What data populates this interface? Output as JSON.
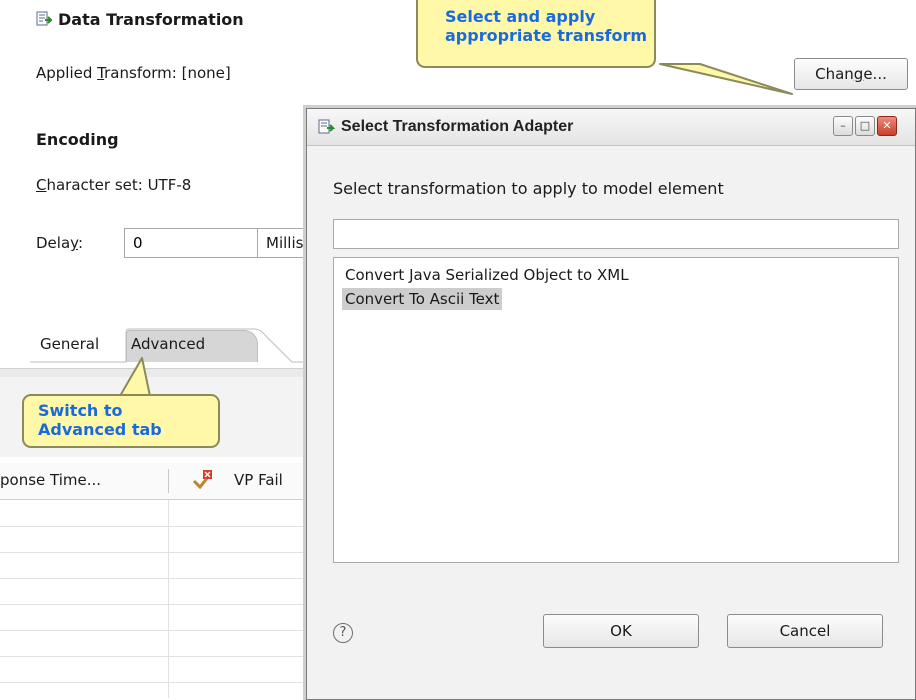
{
  "editor": {
    "section_title": "Data Transformation",
    "applied_transform_pre": "Applied ",
    "applied_transform_mnemonic": "T",
    "applied_transform_post": "ransform: [none]",
    "change_pre": "Chan",
    "change_mnemonic": "g",
    "change_post": "e...",
    "encoding_title": "Encoding",
    "charset_mnemonic": "C",
    "charset_post": "haracter set: UTF-8",
    "delay_pre": "Dela",
    "delay_mnemonic": "y",
    "delay_post": ":",
    "delay_value": "0",
    "delay_unit": "Millis"
  },
  "tabs": [
    {
      "label": "General",
      "selected": false
    },
    {
      "label": "Advanced",
      "selected": true
    }
  ],
  "table": {
    "col_response": "ponse Time...",
    "col_vp": "VP Fail"
  },
  "callouts": {
    "top_line1": "Select and apply",
    "top_line2": "appropriate transform",
    "bottom_line1": "Switch to",
    "bottom_line2": "Advanced tab"
  },
  "dialog": {
    "title": "Select Transformation Adapter",
    "prompt": "Select transformation to apply to model element",
    "filter_value": "",
    "items": [
      {
        "label": "Convert Java Serialized Object to XML",
        "selected": false
      },
      {
        "label": "Convert To Ascii Text",
        "selected": true
      }
    ],
    "help_glyph": "?",
    "ok_label": "OK",
    "cancel_label": "Cancel"
  },
  "colors": {
    "callout_fill": "#fff8a8",
    "callout_text": "#1a6adf",
    "selection": "#cdcdcd"
  }
}
